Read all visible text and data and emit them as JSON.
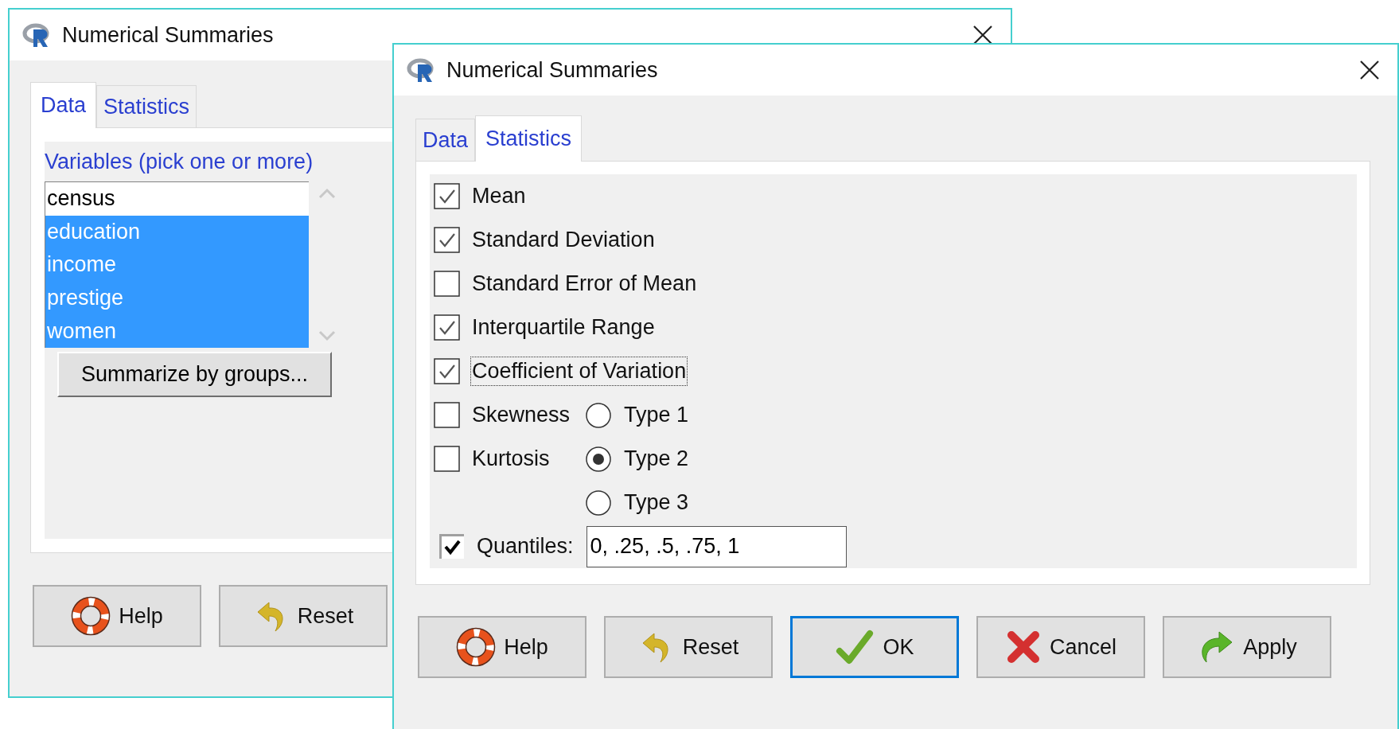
{
  "windows": [
    {
      "title": "Numerical Summaries",
      "tabs": [
        {
          "label": "Data",
          "selected": true
        },
        {
          "label": "Statistics",
          "selected": false
        }
      ],
      "variables_label": "Variables (pick one or more)",
      "variables": [
        {
          "label": "census",
          "selected": false
        },
        {
          "label": "education",
          "selected": true
        },
        {
          "label": "income",
          "selected": true
        },
        {
          "label": "prestige",
          "selected": true
        },
        {
          "label": "women",
          "selected": true
        }
      ],
      "group_button": "Summarize by groups...",
      "buttons": [
        {
          "kind": "help",
          "label": "Help",
          "default": false
        },
        {
          "kind": "reset",
          "label": "Reset",
          "default": false
        }
      ]
    },
    {
      "title": "Numerical Summaries",
      "tabs": [
        {
          "label": "Data",
          "selected": false
        },
        {
          "label": "Statistics",
          "selected": true
        }
      ],
      "checks": [
        {
          "label": "Mean",
          "checked": true,
          "focused": false
        },
        {
          "label": "Standard Deviation",
          "checked": true,
          "focused": false
        },
        {
          "label": "Standard Error of Mean",
          "checked": false,
          "focused": false
        },
        {
          "label": "Interquartile Range",
          "checked": true,
          "focused": false
        },
        {
          "label": "Coefficient of Variation",
          "checked": true,
          "focused": true
        },
        {
          "label": "Skewness",
          "checked": false,
          "focused": false
        },
        {
          "label": "Kurtosis",
          "checked": false,
          "focused": false
        }
      ],
      "types": [
        {
          "label": "Type 1",
          "selected": false
        },
        {
          "label": "Type 2",
          "selected": true
        },
        {
          "label": "Type 3",
          "selected": false
        }
      ],
      "quantiles": {
        "label": "Quantiles:",
        "checked": true,
        "value": "0, .25, .5, .75, 1"
      },
      "buttons": [
        {
          "kind": "help",
          "label": "Help",
          "default": false
        },
        {
          "kind": "reset",
          "label": "Reset",
          "default": false
        },
        {
          "kind": "ok",
          "label": "OK",
          "default": true
        },
        {
          "kind": "cancel",
          "label": "Cancel",
          "default": false
        },
        {
          "kind": "apply",
          "label": "Apply",
          "default": false
        }
      ]
    }
  ]
}
